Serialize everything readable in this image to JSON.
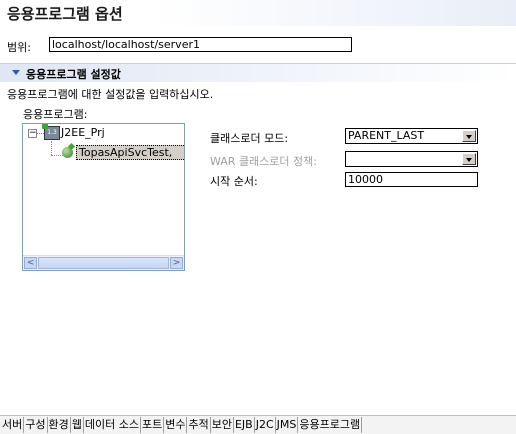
{
  "header": {
    "title": "응용프로그램 옵션"
  },
  "scope": {
    "label": "범위:",
    "value": "localhost/localhost/server1"
  },
  "section": {
    "title": "응용프로그램 설정값"
  },
  "description": "응용프로그램에 대한 설정값을 입력하십시오.",
  "applications": {
    "label": "응용프로그램:",
    "tree": {
      "expander": "−",
      "project": {
        "label": "J2EE_Prj",
        "icon": "j2ee-project-icon",
        "icon_text": "1.3"
      },
      "module": {
        "label": "TopasApiSvcTest,",
        "icon": "web-module-globe-icon"
      }
    },
    "scroll": {
      "left": "<",
      "right": ">"
    }
  },
  "settings": {
    "classloader_mode": {
      "label": "클래스로더 모드:",
      "value": "PARENT_LAST"
    },
    "war_classloader_policy": {
      "label": "WAR 클래스로더 정책:",
      "value": ""
    },
    "start_order": {
      "label": "시작 순서:",
      "value": "10000"
    }
  },
  "tabs": [
    "서버",
    "구성",
    "환경",
    "웹",
    "데이터 소스",
    "포트",
    "변수",
    "추적",
    "보안",
    "EJB",
    "J2C",
    "JMS",
    "응용프로그램"
  ]
}
